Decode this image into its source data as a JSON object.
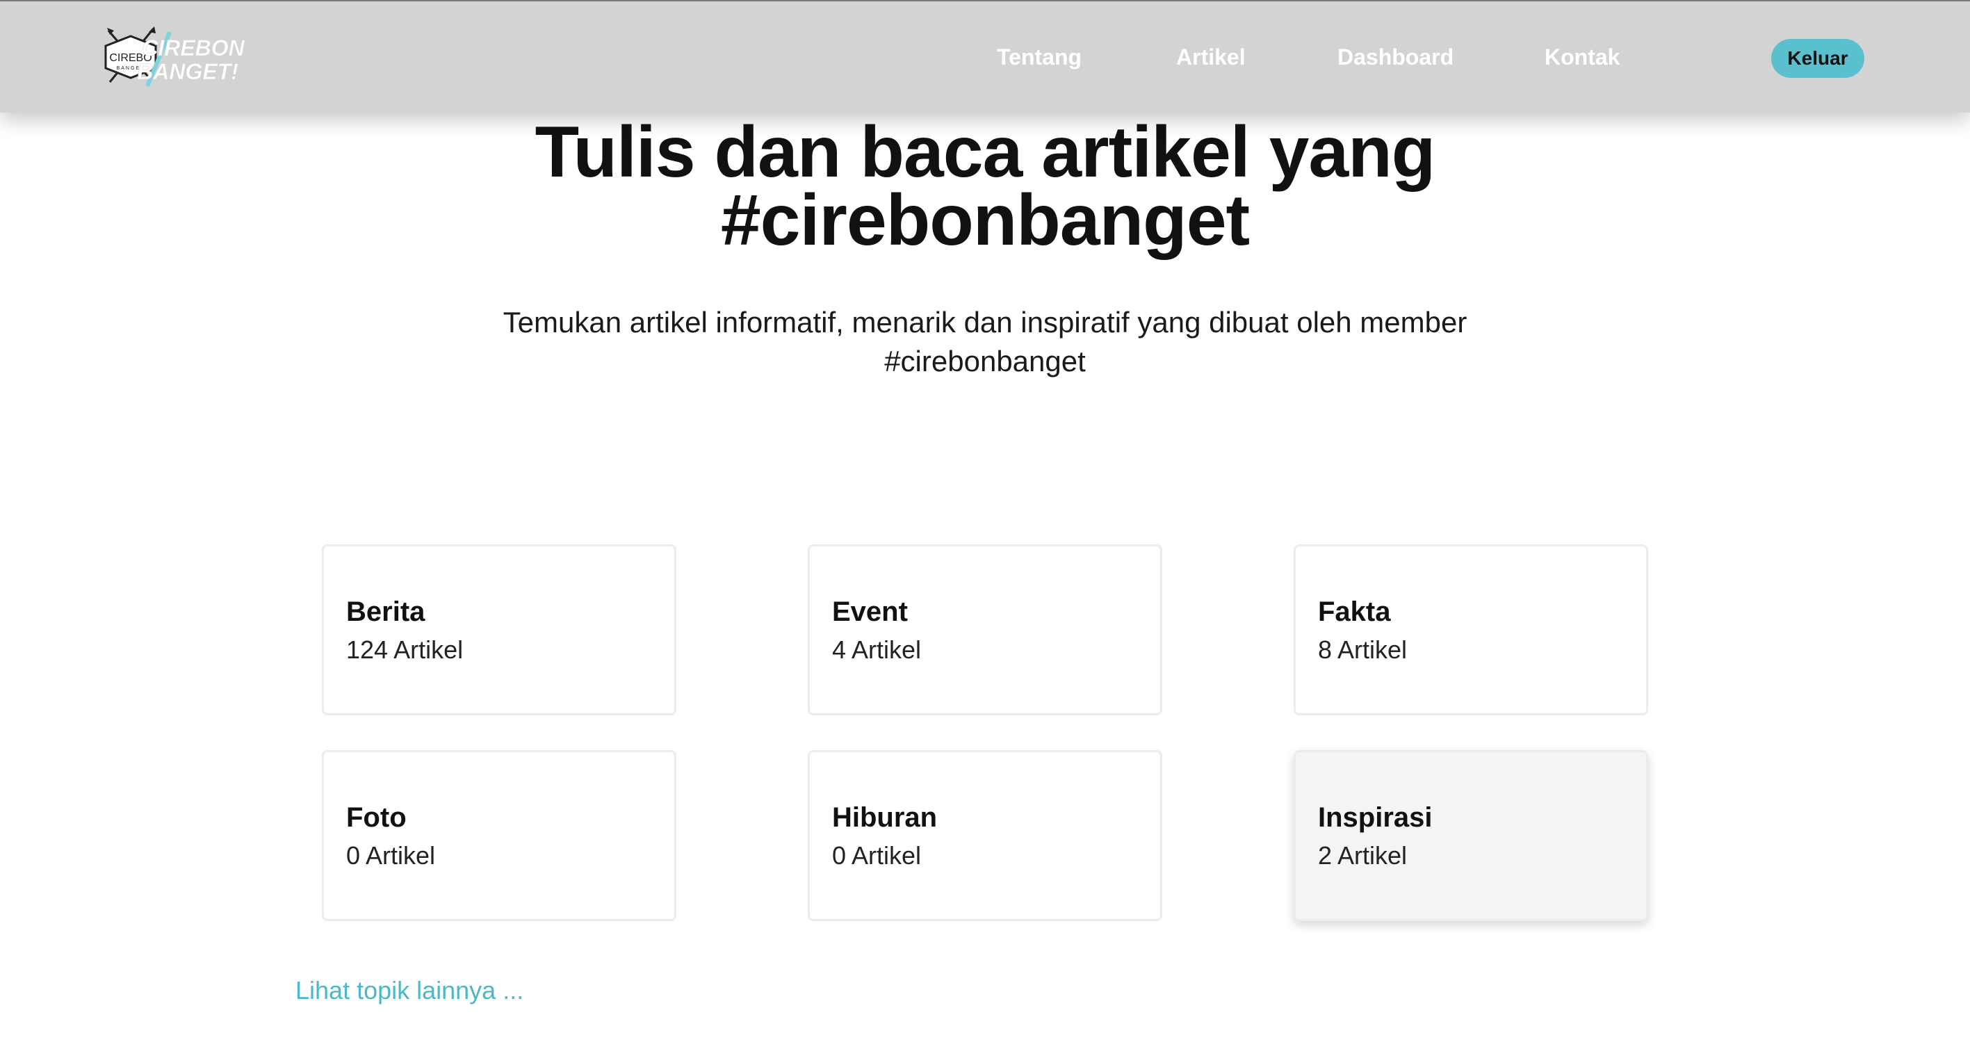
{
  "brand": {
    "logo_text_line1": "CIREBON",
    "logo_text_line2": "BANGET!",
    "badge_text": "CIREBO"
  },
  "nav": {
    "items": [
      {
        "label": "Tentang"
      },
      {
        "label": "Artikel"
      },
      {
        "label": "Dashboard"
      },
      {
        "label": "Kontak"
      }
    ],
    "logout_label": "Keluar"
  },
  "hero": {
    "title_line1": "Tulis dan baca artikel yang",
    "title_line2": "#cirebonbanget",
    "subtitle_line1": "Temukan artikel informatif, menarik dan inspiratif yang dibuat oleh member",
    "subtitle_line2": "#cirebonbanget"
  },
  "categories": [
    {
      "name": "Berita",
      "count": "124 Artikel"
    },
    {
      "name": "Event",
      "count": "4 Artikel"
    },
    {
      "name": "Fakta",
      "count": "8 Artikel"
    },
    {
      "name": "Foto",
      "count": "0 Artikel"
    },
    {
      "name": "Hiburan",
      "count": "0 Artikel"
    },
    {
      "name": "Inspirasi",
      "count": "2 Artikel"
    }
  ],
  "more_topics_label": "Lihat topik lainnya ...",
  "colors": {
    "header_bg": "#d3d3d3",
    "accent": "#5bc0ce",
    "link": "#4bb8c8"
  }
}
